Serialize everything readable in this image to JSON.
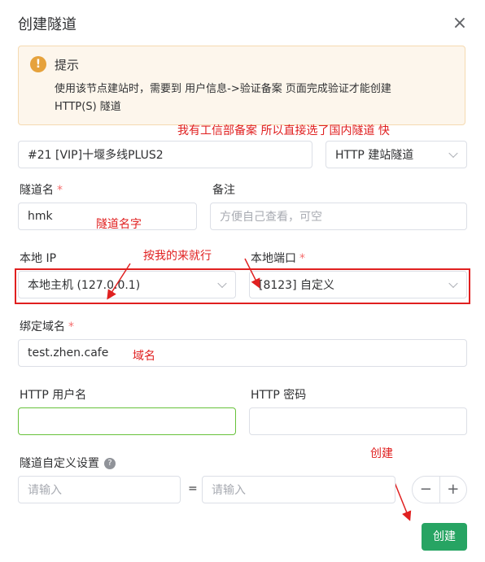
{
  "dialog": {
    "title": "创建隧道",
    "close_icon": "close-icon"
  },
  "alert": {
    "title": "提示",
    "desc": "使用该节点建站时，需要到 用户信息->验证备案 页面完成验证才能创建 HTTP(S) 隧道",
    "icon": "warning-icon"
  },
  "annotations": {
    "a1": "我有工信部备案  所以直接选了国内隧道  快",
    "a2": "隧道名字",
    "a3": "按我的来就行",
    "a4": "域名",
    "a5": "创建"
  },
  "node": {
    "value": "#21 [VIP]十堰多线PLUS2",
    "type_value": "HTTP 建站隧道"
  },
  "tunnel_name": {
    "label": "隧道名",
    "value": "hmk"
  },
  "remark": {
    "label": "备注",
    "placeholder": "方便自己查看，可空"
  },
  "local_ip": {
    "label": "本地 IP",
    "value": "本地主机 (127.0.0.1)"
  },
  "local_port": {
    "label": "本地端口",
    "value": "[8123] 自定义"
  },
  "domain": {
    "label": "绑定域名",
    "value": "test.zhen.cafe"
  },
  "http_user": {
    "label": "HTTP 用户名"
  },
  "http_pass": {
    "label": "HTTP 密码"
  },
  "custom": {
    "label": "隧道自定义设置",
    "placeholder_key": "请输入",
    "equals": "=",
    "placeholder_value": "请输入"
  },
  "stepper": {
    "minus": "−",
    "plus": "+"
  },
  "submit": {
    "label": "创建"
  },
  "colors": {
    "accent": "#27a463",
    "annotation": "#e02020",
    "warning": "#e6a23c"
  }
}
